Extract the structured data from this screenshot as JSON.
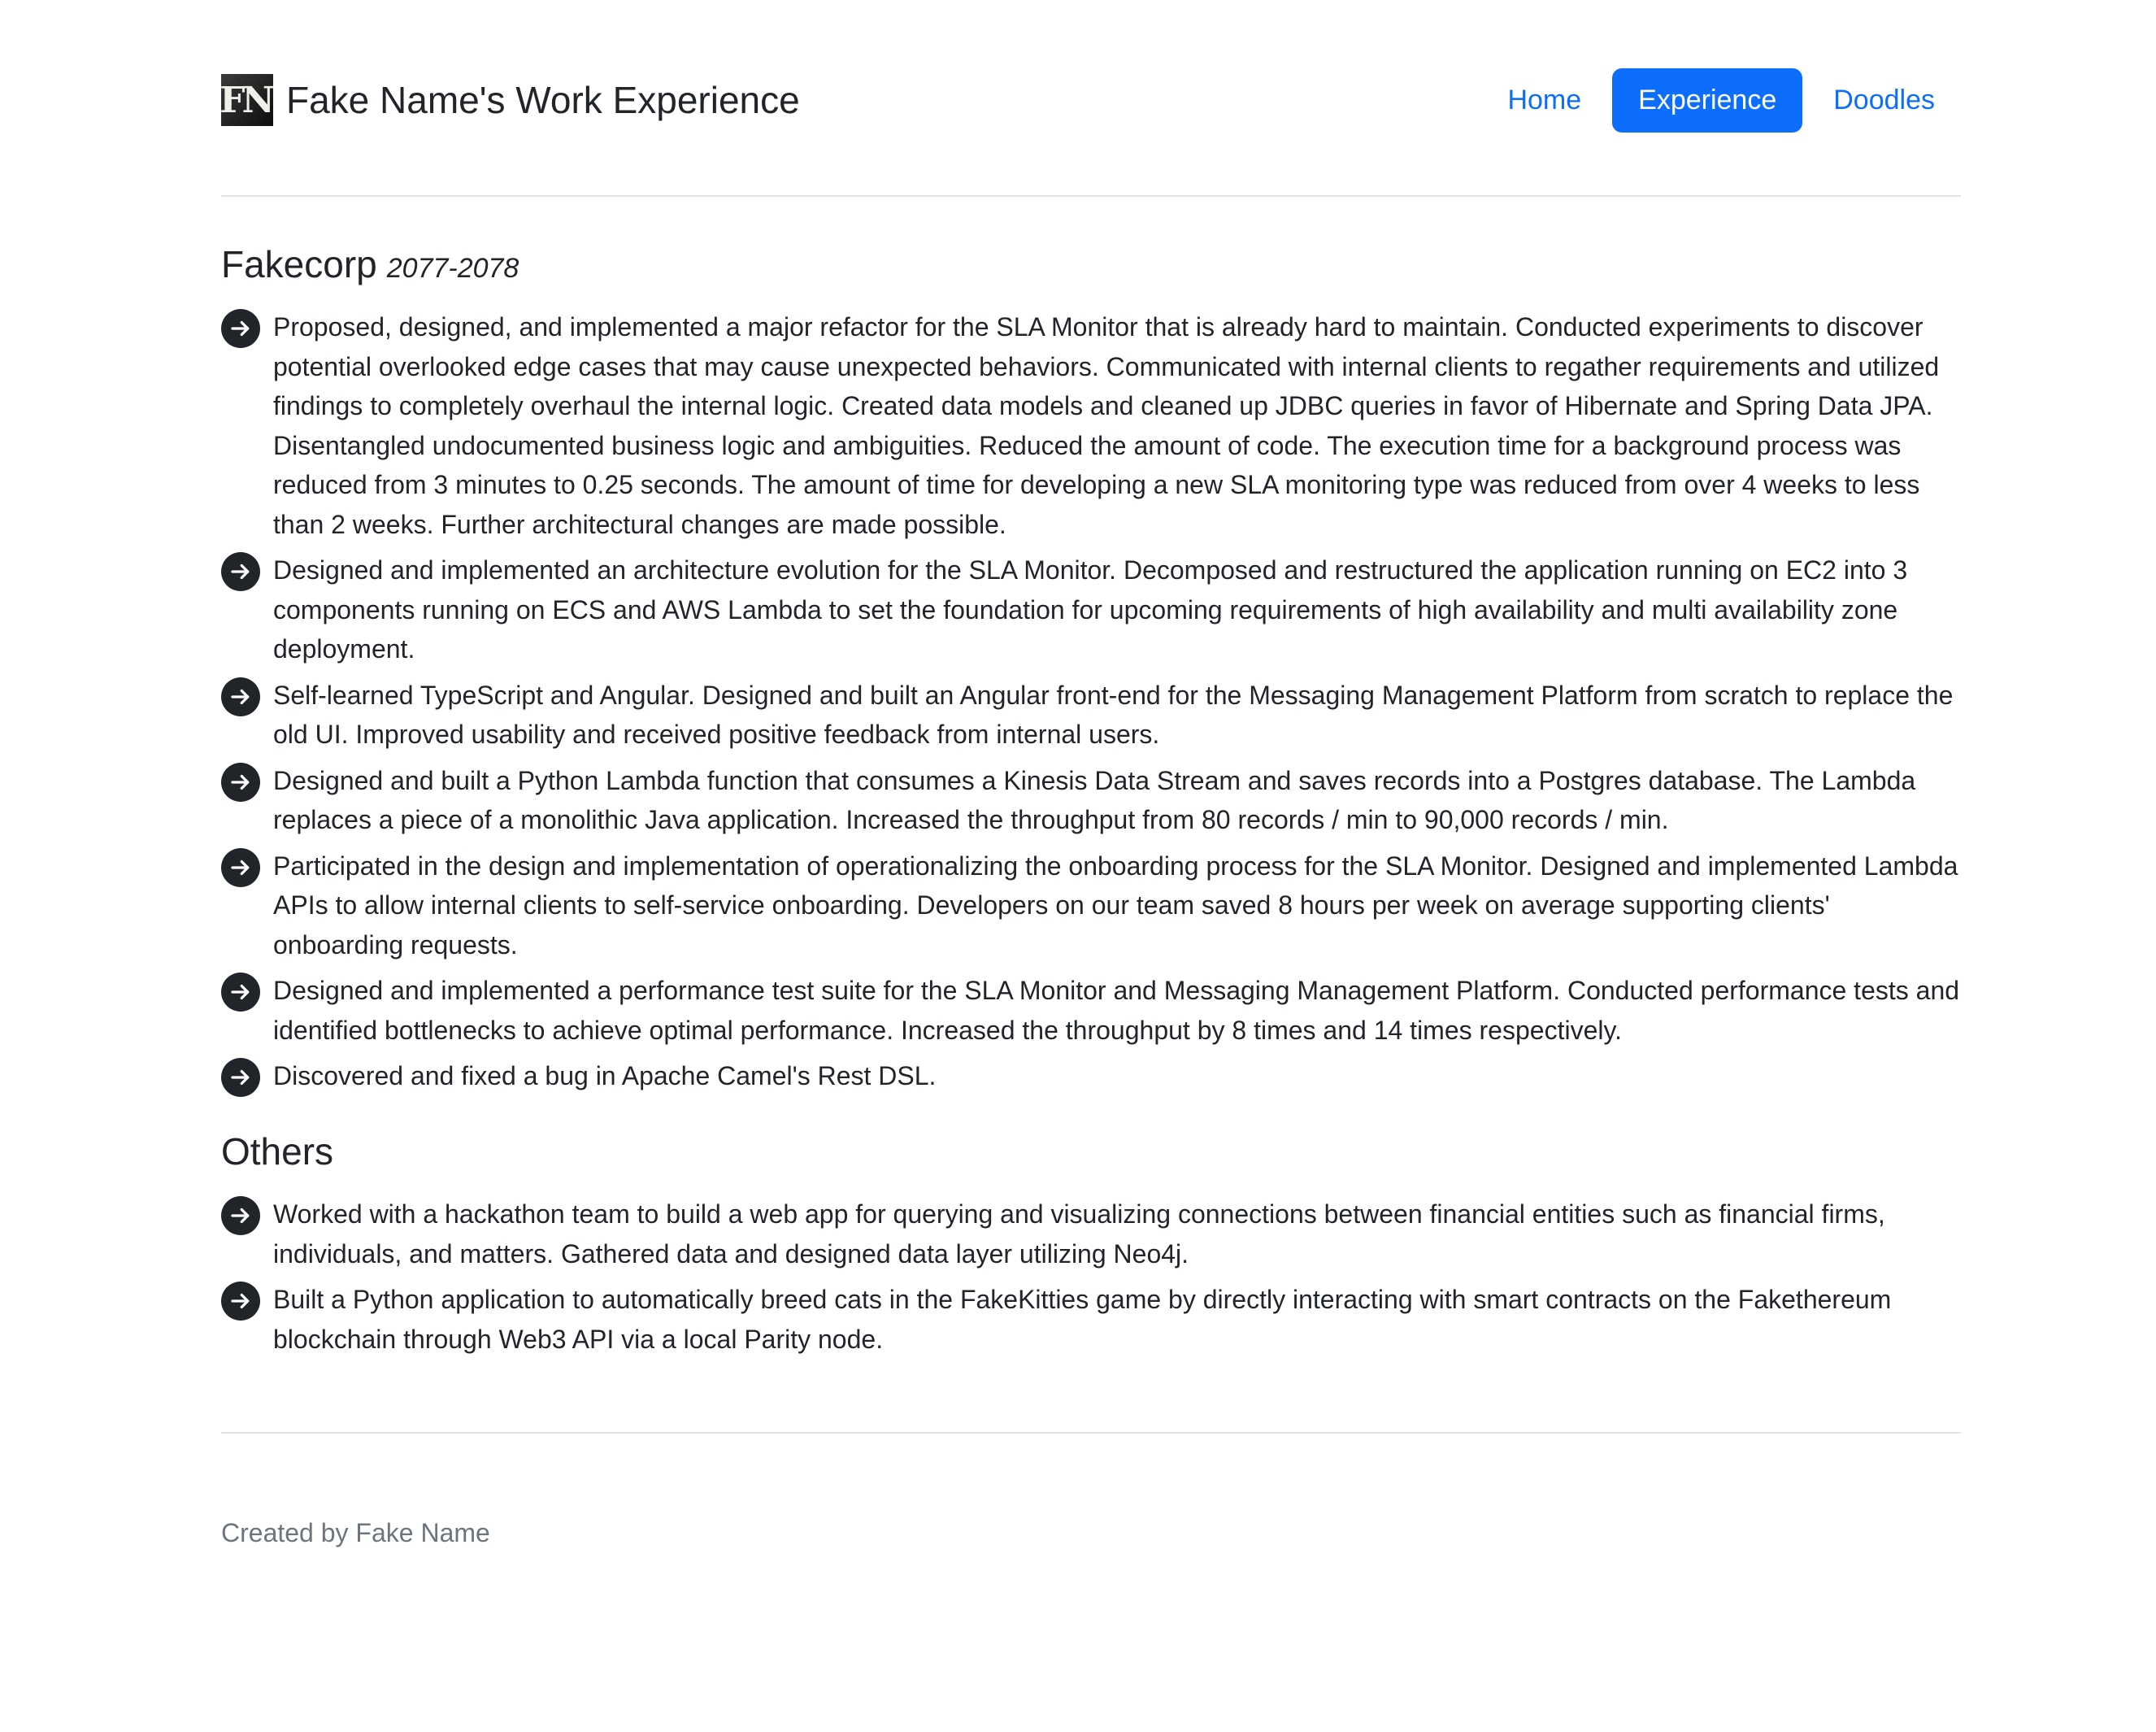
{
  "header": {
    "logo_text": "FN",
    "title": "Fake Name's Work Experience",
    "nav": [
      {
        "label": "Home",
        "active": false
      },
      {
        "label": "Experience",
        "active": true
      },
      {
        "label": "Doodles",
        "active": false
      }
    ]
  },
  "job": {
    "company": "Fakecorp",
    "years": "2077-2078",
    "items": [
      "Proposed, designed, and implemented a major refactor for the SLA Monitor that is already hard to maintain. Conducted experiments to discover potential overlooked edge cases that may cause unexpected behaviors. Communicated with internal clients to regather requirements and utilized findings to completely overhaul the internal logic. Created data models and cleaned up JDBC queries in favor of Hibernate and Spring Data JPA. Disentangled undocumented business logic and ambiguities. Reduced the amount of code. The execution time for a background process was reduced from 3 minutes to 0.25 seconds. The amount of time for developing a new SLA monitoring type was reduced from over 4 weeks to less than 2 weeks. Further architectural changes are made possible.",
      "Designed and implemented an architecture evolution for the SLA Monitor. Decomposed and restructured the application running on EC2 into 3 components running on ECS and AWS Lambda to set the foundation for upcoming requirements of high availability and multi availability zone deployment.",
      "Self-learned TypeScript and Angular. Designed and built an Angular front-end for the Messaging Management Platform from scratch to replace the old UI. Improved usability and received positive feedback from internal users.",
      "Designed and built a Python Lambda function that consumes a Kinesis Data Stream and saves records into a Postgres database. The Lambda replaces a piece of a monolithic Java application. Increased the throughput from 80 records / min to 90,000 records / min.",
      "Participated in the design and implementation of operationalizing the onboarding process for the SLA Monitor. Designed and implemented Lambda APIs to allow internal clients to self-service onboarding. Developers on our team saved 8 hours per week on average supporting clients' onboarding requests.",
      "Designed and implemented a performance test suite for the SLA Monitor and Messaging Management Platform. Conducted performance tests and identified bottlenecks to achieve optimal performance. Increased the throughput by 8 times and 14 times respectively.",
      "Discovered and fixed a bug in Apache Camel's Rest DSL."
    ]
  },
  "others": {
    "heading": "Others",
    "items": [
      "Worked with a hackathon team to build a web app for querying and visualizing connections between financial entities such as financial firms, individuals, and matters. Gathered data and designed data layer utilizing Neo4j.",
      "Built a Python application to automatically breed cats in the FakeKitties game by directly interacting with smart contracts on the Fakethereum blockchain through Web3 API via a local Parity node."
    ]
  },
  "footer": {
    "credit": "Created by Fake Name"
  },
  "colors": {
    "link": "#0d6efd",
    "text": "#212529",
    "muted": "#6c757d",
    "divider": "#dee2e6"
  },
  "icons": {
    "bullet": "arrow-right-circle-icon",
    "logo": "fn-logo"
  }
}
